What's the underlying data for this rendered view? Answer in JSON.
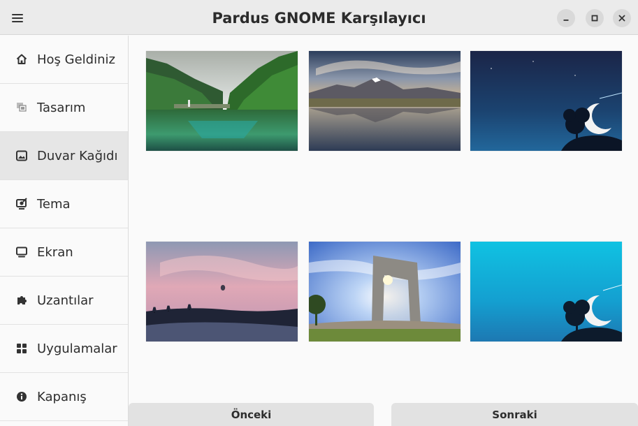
{
  "window": {
    "title": "Pardus GNOME Karşılayıcı"
  },
  "header": {
    "menu_icon": "hamburger-menu-icon",
    "controls": {
      "minimize_icon": "minimize-icon",
      "maximize_icon": "maximize-icon",
      "close_icon": "close-icon"
    }
  },
  "sidebar": {
    "items": [
      {
        "label": "Hoş Geldiniz",
        "icon": "home-icon"
      },
      {
        "label": "Tasarım",
        "icon": "layers-icon"
      },
      {
        "label": "Duvar Kağıdı",
        "icon": "image-icon",
        "selected": true
      },
      {
        "label": "Tema",
        "icon": "theme-icon"
      },
      {
        "label": "Ekran",
        "icon": "monitor-icon"
      },
      {
        "label": "Uzantılar",
        "icon": "puzzle-icon"
      },
      {
        "label": "Uygulamalar",
        "icon": "apps-grid-icon"
      },
      {
        "label": "Kapanış",
        "icon": "info-icon"
      }
    ]
  },
  "wallpapers": [
    {
      "name": "lake-valley-wallpaper"
    },
    {
      "name": "mountain-reflection-wallpaper"
    },
    {
      "name": "night-moon-tree-wallpaper"
    },
    {
      "name": "pink-sky-balloon-wallpaper"
    },
    {
      "name": "monument-sunburst-wallpaper"
    },
    {
      "name": "cyan-moon-tree-wallpaper"
    }
  ],
  "footer": {
    "prev_label": "Önceki",
    "next_label": "Sonraki"
  },
  "colors": {
    "header_bg": "#ebebeb",
    "sidebar_selected": "#e6e6e6",
    "button_bg": "#e2e2e2"
  }
}
